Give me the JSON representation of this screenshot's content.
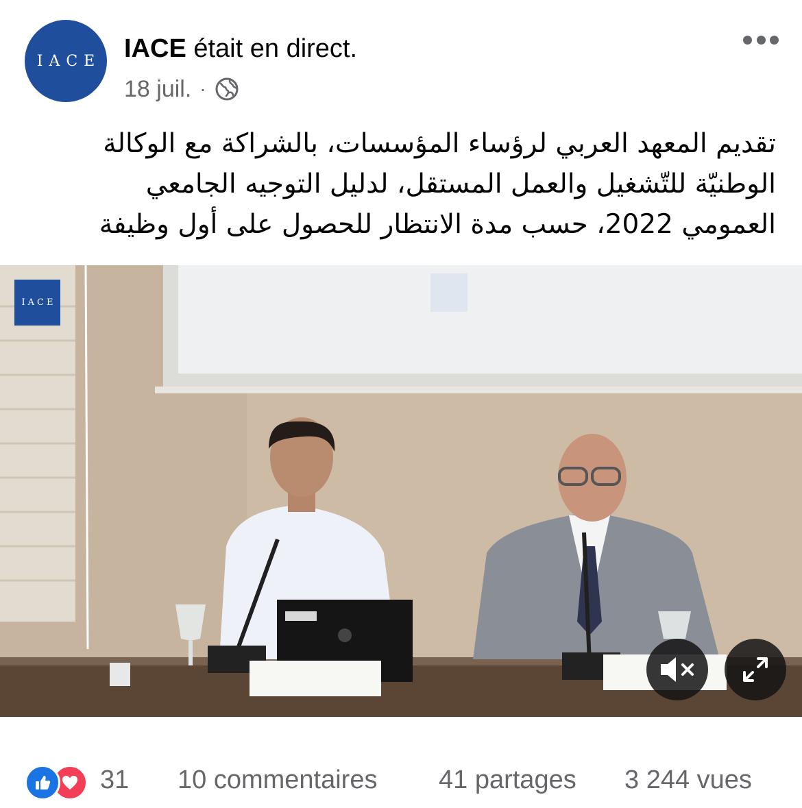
{
  "post": {
    "avatar_text": "IACE",
    "page_name": "IACE",
    "action": "était en direct.",
    "date": "18 juil.",
    "separator": "·",
    "privacy_icon": "globe-icon",
    "more_icon": "more-dots-icon",
    "text_lines": [
      "تقديم المعهد العربي لرؤساء المؤسسات، بالشراكة مع الوكالة",
      "الوطنيّة للتّشغيل والعمل المستقل، لدليل التوجيه الجامعي",
      "العمومي 2022، حسب مدة الانتظار للحصول على أول وظيفة"
    ]
  },
  "video": {
    "watermark": "IACE",
    "mute_icon": "volume-muted-icon",
    "fullscreen_icon": "fullscreen-icon"
  },
  "stats": {
    "reaction_icons": [
      "like-icon",
      "love-icon"
    ],
    "reactions_count": "31",
    "comments": "10 commentaires",
    "shares": "41 partages",
    "views": "3 244 vues"
  },
  "colors": {
    "brand": "#1f4e9c",
    "like": "#1b74e4",
    "love": "#f33e58",
    "secondary_text": "#65676b"
  }
}
